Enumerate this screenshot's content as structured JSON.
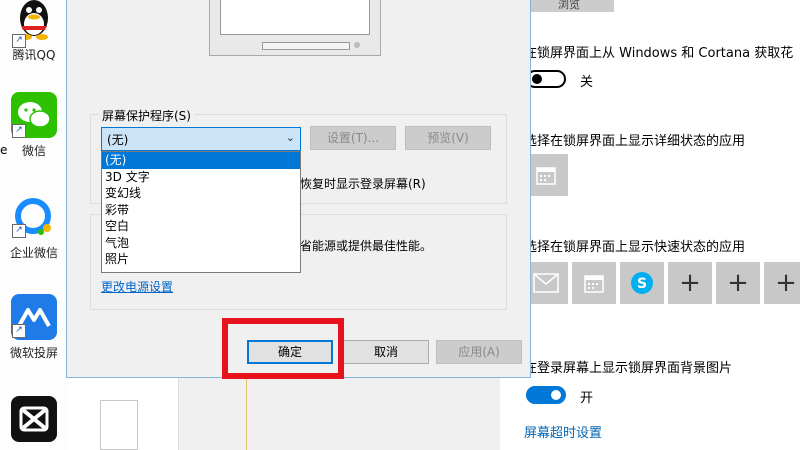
{
  "desktop": {
    "items": [
      {
        "label": "腾讯QQ",
        "icon": "qq-penguin-icon"
      },
      {
        "label": "微信",
        "icon": "wechat-icon"
      },
      {
        "label": "企业微信",
        "icon": "wecom-icon"
      },
      {
        "label": "微软投屏",
        "icon": "screen-cast-icon"
      },
      {
        "label": "",
        "icon": "capcut-icon"
      }
    ],
    "left_cut_text": "e"
  },
  "dialog": {
    "group_title": "屏幕保护程序(S)",
    "selected_value": "(无)",
    "settings_button": "设置(T)...",
    "preview_button": "预览(V)",
    "resume_text": "恢复时显示登录屏幕(R)",
    "power_text": "省能源或提供最佳性能。",
    "power_link": "更改电源设置",
    "ok_button": "确定",
    "cancel_button": "取消",
    "apply_button": "应用(A)",
    "options": [
      "(无)",
      "3D 文字",
      "变幻线",
      "彩带",
      "空白",
      "气泡",
      "照片"
    ]
  },
  "settings": {
    "top_button": "浏览",
    "fun_facts_text": "在锁屏界面上从 Windows 和 Cortana 获取花",
    "fun_facts_state": "关",
    "detailed_status_text": "选择在锁屏界面上显示详细状态的应用",
    "quick_status_text": "选择在锁屏界面上显示快速状态的应用",
    "signin_bg_text": "在登录屏幕上显示锁屏界面背景图片",
    "signin_bg_state": "开",
    "timeout_link": "屏幕超时设置",
    "colors": {
      "accent": "#0078d7",
      "highlight": "#e8121e"
    }
  }
}
